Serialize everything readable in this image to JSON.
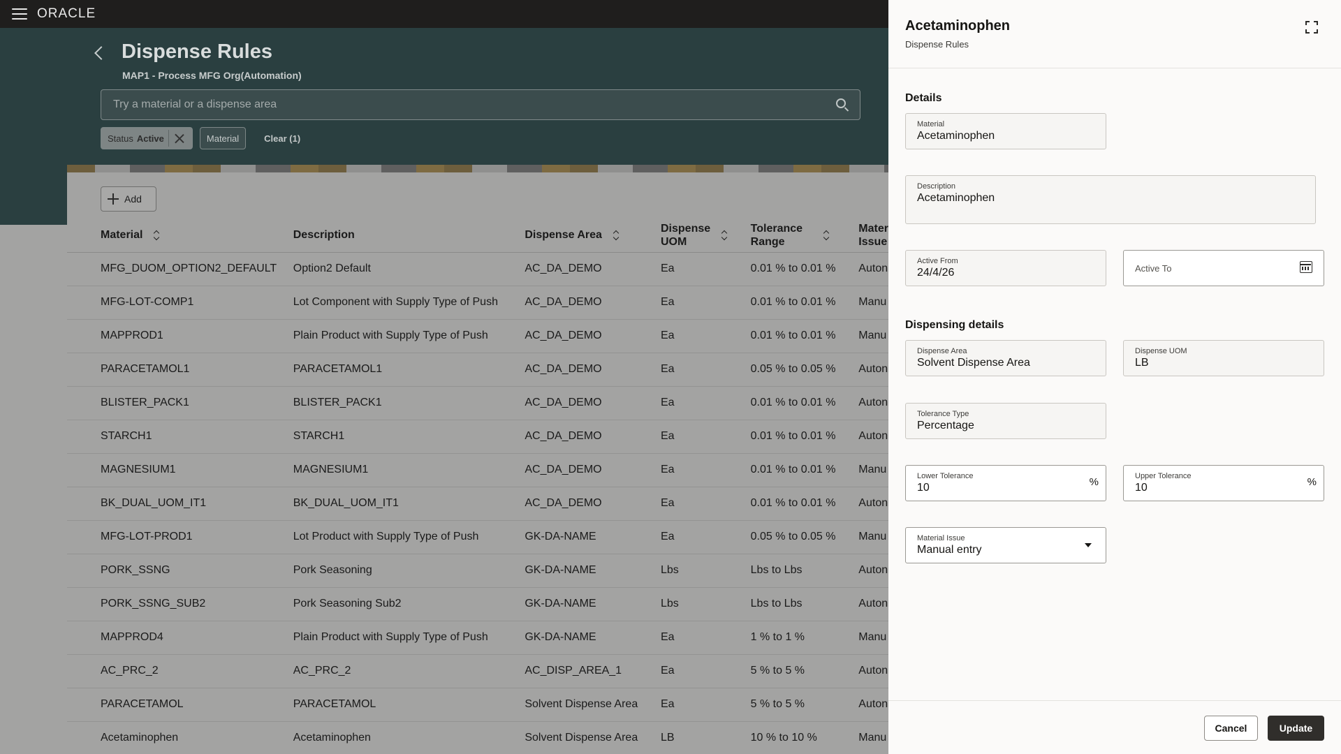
{
  "app": {
    "logo": "ORACLE"
  },
  "page": {
    "title": "Dispense Rules",
    "subtitle": "MAP1 - Process MFG Org(Automation)",
    "search_placeholder": "Try a material or a dispense area",
    "filters": {
      "status_label": "Status",
      "status_value": "Active",
      "material_label": "Material",
      "clear_label": "Clear (1)"
    },
    "add_label": "Add"
  },
  "table": {
    "headers": {
      "material": "Material",
      "description": "Description",
      "dispense_area": "Dispense Area",
      "dispense_uom_1": "Dispense",
      "dispense_uom_2": "UOM",
      "tolerance_1": "Tolerance",
      "tolerance_2": "Range",
      "issue_1": "Mater",
      "issue_2": "Issue"
    },
    "rows": [
      [
        "MFG_DUOM_OPTION2_DEFAULT",
        "Option2 Default",
        "AC_DA_DEMO",
        "Ea",
        "0.01 % to 0.01 %",
        "Auton"
      ],
      [
        "MFG-LOT-COMP1",
        "Lot Component with Supply Type of Push",
        "AC_DA_DEMO",
        "Ea",
        "0.01 % to 0.01 %",
        "Manu"
      ],
      [
        "MAPPROD1",
        "Plain Product with Supply Type of Push",
        "AC_DA_DEMO",
        "Ea",
        "0.01 % to 0.01 %",
        "Manu"
      ],
      [
        "PARACETAMOL1",
        "PARACETAMOL1",
        "AC_DA_DEMO",
        "Ea",
        "0.05 % to 0.05 %",
        "Auton"
      ],
      [
        "BLISTER_PACK1",
        "BLISTER_PACK1",
        "AC_DA_DEMO",
        "Ea",
        "0.01 % to 0.01 %",
        "Auton"
      ],
      [
        "STARCH1",
        "STARCH1",
        "AC_DA_DEMO",
        "Ea",
        "0.01 % to 0.01 %",
        "Auton"
      ],
      [
        "MAGNESIUM1",
        "MAGNESIUM1",
        "AC_DA_DEMO",
        "Ea",
        "0.01 % to 0.01 %",
        "Manu"
      ],
      [
        "BK_DUAL_UOM_IT1",
        "BK_DUAL_UOM_IT1",
        "AC_DA_DEMO",
        "Ea",
        "0.01 % to 0.01 %",
        "Auton"
      ],
      [
        "MFG-LOT-PROD1",
        "Lot Product with Supply Type of Push",
        "GK-DA-NAME",
        "Ea",
        "0.05 % to 0.05 %",
        "Manu"
      ],
      [
        "PORK_SSNG",
        "Pork Seasoning",
        "GK-DA-NAME",
        "Lbs",
        "Lbs to Lbs",
        "Auton"
      ],
      [
        "PORK_SSNG_SUB2",
        "Pork Seasoning Sub2",
        "GK-DA-NAME",
        "Lbs",
        "Lbs to Lbs",
        "Auton"
      ],
      [
        "MAPPROD4",
        "Plain Product with Supply Type of Push",
        "GK-DA-NAME",
        "Ea",
        "1 % to 1 %",
        "Manu"
      ],
      [
        "AC_PRC_2",
        "AC_PRC_2",
        "AC_DISP_AREA_1",
        "Ea",
        "5 % to 5 %",
        "Auton"
      ],
      [
        "PARACETAMOL",
        "PARACETAMOL",
        "Solvent Dispense Area",
        "Ea",
        "5 % to 5 %",
        "Auton"
      ],
      [
        "Acetaminophen",
        "Acetaminophen",
        "Solvent Dispense Area",
        "LB",
        "10 % to 10 %",
        "Manu"
      ]
    ]
  },
  "drawer": {
    "title": "Acetaminophen",
    "subtitle": "Dispense Rules",
    "details_title": "Details",
    "material": {
      "label": "Material",
      "value": "Acetaminophen"
    },
    "description": {
      "label": "Description",
      "value": "Acetaminophen"
    },
    "active_from": {
      "label": "Active From",
      "value": "24/4/26"
    },
    "active_to": {
      "label": "Active To"
    },
    "dispensing_title": "Dispensing details",
    "dispense_area": {
      "label": "Dispense Area",
      "value": "Solvent Dispense Area"
    },
    "dispense_uom": {
      "label": "Dispense UOM",
      "value": "LB"
    },
    "tolerance_type": {
      "label": "Tolerance Type",
      "value": "Percentage"
    },
    "lower_tolerance": {
      "label": "Lower Tolerance",
      "value": "10",
      "unit": "%"
    },
    "upper_tolerance": {
      "label": "Upper Tolerance",
      "value": "10",
      "unit": "%"
    },
    "material_issue": {
      "label": "Material Issue",
      "value": "Manual entry"
    },
    "cancel_label": "Cancel",
    "update_label": "Update"
  }
}
